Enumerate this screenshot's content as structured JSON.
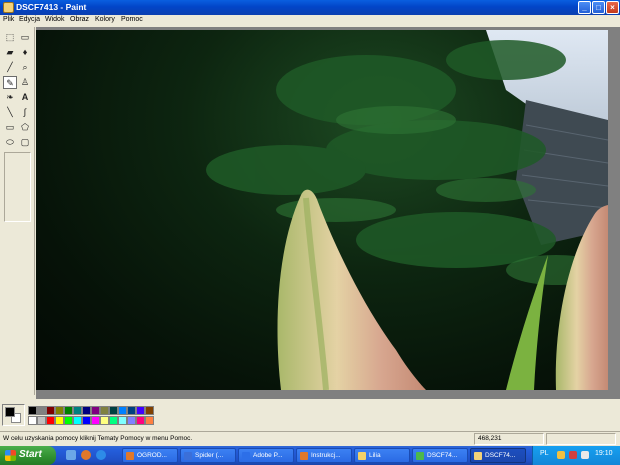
{
  "window": {
    "title": "DSCF7413 - Paint"
  },
  "menu": [
    "Plik",
    "Edycja",
    "Widok",
    "Obraz",
    "Kolory",
    "Pomoc"
  ],
  "tools": [
    {
      "name": "free-select-icon",
      "glyph": "⬚"
    },
    {
      "name": "rect-select-icon",
      "glyph": "▭"
    },
    {
      "name": "eraser-icon",
      "glyph": "▰"
    },
    {
      "name": "fill-bucket-icon",
      "glyph": "♦"
    },
    {
      "name": "color-picker-icon",
      "glyph": "╱"
    },
    {
      "name": "magnifier-icon",
      "glyph": "⌕"
    },
    {
      "name": "pencil-icon",
      "glyph": "✎"
    },
    {
      "name": "brush-icon",
      "glyph": "♙"
    },
    {
      "name": "airbrush-icon",
      "glyph": "❧"
    },
    {
      "name": "text-icon",
      "glyph": "A"
    },
    {
      "name": "line-icon",
      "glyph": "╲"
    },
    {
      "name": "curve-icon",
      "glyph": "∫"
    },
    {
      "name": "rectangle-icon",
      "glyph": "▭"
    },
    {
      "name": "polygon-icon",
      "glyph": "⬠"
    },
    {
      "name": "ellipse-icon",
      "glyph": "⬭"
    },
    {
      "name": "rounded-rect-icon",
      "glyph": "▢"
    }
  ],
  "palette": {
    "foreground": "#000000",
    "background": "#ffffff",
    "top_row": [
      "#000000",
      "#808080",
      "#800000",
      "#808000",
      "#008000",
      "#008080",
      "#000080",
      "#800080",
      "#808040",
      "#004040",
      "#0080ff",
      "#004080",
      "#4000ff",
      "#804000"
    ],
    "bottom_row": [
      "#ffffff",
      "#c0c0c0",
      "#ff0000",
      "#ffff00",
      "#00ff00",
      "#00ffff",
      "#0000ff",
      "#ff00ff",
      "#ffff80",
      "#00ff80",
      "#80ffff",
      "#8080ff",
      "#ff0080",
      "#ff8040"
    ]
  },
  "status": {
    "help_text": "W celu uzyskania pomocy kliknij Tematy Pomocy w menu Pomoc.",
    "coords": "468,231"
  },
  "taskbar": {
    "start_label": "Start",
    "tasks": [
      {
        "label": "OGROD...",
        "icon_color": "#e0782a"
      },
      {
        "label": "Spider (...",
        "icon_color": "#3b6fd9"
      },
      {
        "label": "Adobe P...",
        "icon_color": "#2d6fe8"
      },
      {
        "label": "Instrukcj...",
        "icon_color": "#e0782a"
      },
      {
        "label": "Lilia",
        "icon_color": "#f3d166"
      },
      {
        "label": "DSCF74...",
        "icon_color": "#4cb84c"
      },
      {
        "label": "DSCF74...",
        "icon_color": "#f2d27a"
      }
    ],
    "language": "PL",
    "clock": "19:10"
  }
}
